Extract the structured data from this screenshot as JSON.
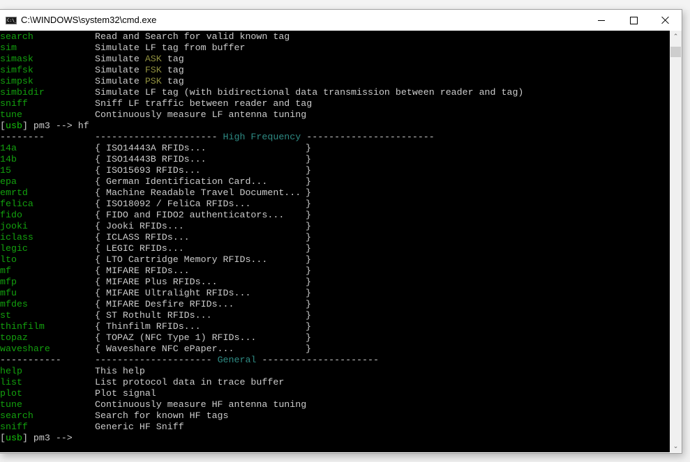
{
  "window": {
    "title": "C:\\WINDOWS\\system32\\cmd.exe",
    "icon": "cmd-icon",
    "icon_text": "C:\\_",
    "controls": {
      "minimize": "minimize-icon",
      "maximize": "maximize-icon",
      "close": "close-icon"
    }
  },
  "console": {
    "lf_commands": [
      {
        "cmd": "search",
        "desc": "Read and Search for valid known tag"
      },
      {
        "cmd": "sim",
        "desc": "Simulate LF tag from buffer"
      },
      {
        "cmd": "simask",
        "desc_pre": "Simulate ",
        "desc_hl": "ASK",
        "desc_post": " tag"
      },
      {
        "cmd": "simfsk",
        "desc_pre": "Simulate ",
        "desc_hl": "FSK",
        "desc_post": " tag"
      },
      {
        "cmd": "simpsk",
        "desc_pre": "Simulate ",
        "desc_hl": "PSK",
        "desc_post": " tag"
      },
      {
        "cmd": "simbidir",
        "desc": "Simulate LF tag (with bidirectional data transmission between reader and tag)"
      },
      {
        "cmd": "sniff",
        "desc": "Sniff LF traffic between reader and tag"
      },
      {
        "cmd": "tune",
        "desc": "Continuously measure LF antenna tuning"
      }
    ],
    "prompt1": {
      "open": "[",
      "conn": "usb",
      "close": "] pm3 --> ",
      "input": "hf"
    },
    "hf_header": {
      "left_dashes": "--------",
      "mid_left": "---------------------- ",
      "title": "High Frequency",
      "mid_right": " -----------------------"
    },
    "hf_commands": [
      {
        "cmd": "14a",
        "desc": "{ ISO14443A RFIDs...",
        "close": "}"
      },
      {
        "cmd": "14b",
        "desc": "{ ISO14443B RFIDs...",
        "close": "}"
      },
      {
        "cmd": "15",
        "desc": "{ ISO15693 RFIDs...",
        "close": "}"
      },
      {
        "cmd": "epa",
        "desc": "{ German Identification Card...",
        "close": "}"
      },
      {
        "cmd": "emrtd",
        "desc": "{ Machine Readable Travel Document...",
        "close": "}"
      },
      {
        "cmd": "felica",
        "desc": "{ ISO18092 / FeliCa RFIDs...",
        "close": "}"
      },
      {
        "cmd": "fido",
        "desc": "{ FIDO and FIDO2 authenticators...",
        "close": "}"
      },
      {
        "cmd": "jooki",
        "desc": "{ Jooki RFIDs...",
        "close": "}"
      },
      {
        "cmd": "iclass",
        "desc": "{ ICLASS RFIDs...",
        "close": "}"
      },
      {
        "cmd": "legic",
        "desc": "{ LEGIC RFIDs...",
        "close": "}"
      },
      {
        "cmd": "lto",
        "desc": "{ LTO Cartridge Memory RFIDs...",
        "close": "}"
      },
      {
        "cmd": "mf",
        "desc": "{ MIFARE RFIDs...",
        "close": "}"
      },
      {
        "cmd": "mfp",
        "desc": "{ MIFARE Plus RFIDs...",
        "close": "}"
      },
      {
        "cmd": "mfu",
        "desc": "{ MIFARE Ultralight RFIDs...",
        "close": "}"
      },
      {
        "cmd": "mfdes",
        "desc": "{ MIFARE Desfire RFIDs...",
        "close": "}"
      },
      {
        "cmd": "st",
        "desc": "{ ST Rothult RFIDs...",
        "close": "}"
      },
      {
        "cmd": "thinfilm",
        "desc": "{ Thinfilm RFIDs...",
        "close": "}"
      },
      {
        "cmd": "topaz",
        "desc": "{ TOPAZ (NFC Type 1) RFIDs...",
        "close": "}"
      },
      {
        "cmd": "waveshare",
        "desc": "{ Waveshare NFC ePaper...",
        "close": "}"
      }
    ],
    "general_header": {
      "left_dashes": "-----------",
      "mid_left": "--------------------- ",
      "title": "General",
      "mid_right": " ---------------------"
    },
    "general_commands": [
      {
        "cmd": "help",
        "desc": "This help"
      },
      {
        "cmd": "list",
        "desc": "List protocol data in trace buffer"
      },
      {
        "cmd": "plot",
        "desc": "Plot signal"
      },
      {
        "cmd": "tune",
        "desc": "Continuously measure HF antenna tuning"
      },
      {
        "cmd": "search",
        "desc": "Search for known HF tags"
      },
      {
        "cmd": "sniff",
        "desc": "Generic HF Sniff"
      }
    ],
    "prompt2": {
      "open": "[",
      "conn": "usb",
      "close": "] pm3 -->",
      "input": ""
    }
  },
  "scrollbar": {
    "up": "scroll-up-arrow-icon",
    "down": "scroll-down-arrow-icon",
    "up_glyph": "⌃",
    "down_glyph": "⌄"
  },
  "colors": {
    "console_bg": "#000000",
    "command": "#13a10e",
    "text": "#cccccc",
    "highlight": "#8f8f3f",
    "section_title": "#2e8b84",
    "prompt_conn": "#16c60c"
  }
}
